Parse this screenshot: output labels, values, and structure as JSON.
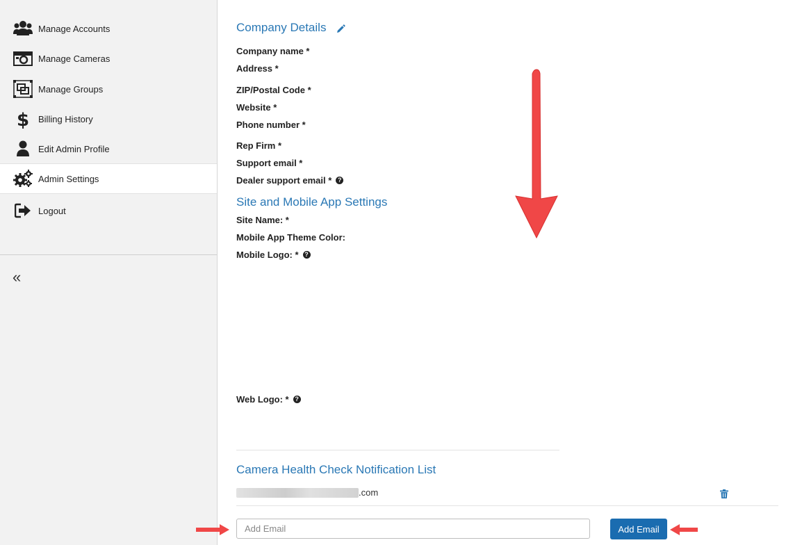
{
  "sidebar": {
    "items": [
      {
        "label": "Manage Accounts",
        "icon": "users-icon"
      },
      {
        "label": "Manage Cameras",
        "icon": "camera-icon"
      },
      {
        "label": "Manage Groups",
        "icon": "groups-icon"
      },
      {
        "label": "Billing History",
        "icon": "dollar-icon"
      },
      {
        "label": "Edit Admin Profile",
        "icon": "user-icon"
      },
      {
        "label": "Admin Settings",
        "icon": "gears-icon"
      },
      {
        "label": "Logout",
        "icon": "logout-icon"
      }
    ],
    "active_index": 5,
    "collapse_glyph": "«"
  },
  "company": {
    "title": "Company Details",
    "fields": {
      "company_name": "Company name *",
      "address": "Address *",
      "zip": "ZIP/Postal Code *",
      "website": "Website *",
      "phone": "Phone number *",
      "rep_firm": "Rep Firm *",
      "support_email": "Support email *",
      "dealer_support_email": "Dealer support email *"
    }
  },
  "site": {
    "title": "Site and Mobile App Settings",
    "fields": {
      "site_name": "Site Name: *",
      "theme_color": "Mobile App Theme Color:",
      "mobile_logo": "Mobile Logo: *",
      "web_logo": "Web Logo: *"
    }
  },
  "health": {
    "title": "Camera Health Check Notification List",
    "email_suffix": ".com",
    "add_placeholder": "Add Email",
    "add_button": "Add Email"
  },
  "colors": {
    "accent": "#2a78b5",
    "button": "#1a6cb0",
    "annotation": "#f04747"
  }
}
